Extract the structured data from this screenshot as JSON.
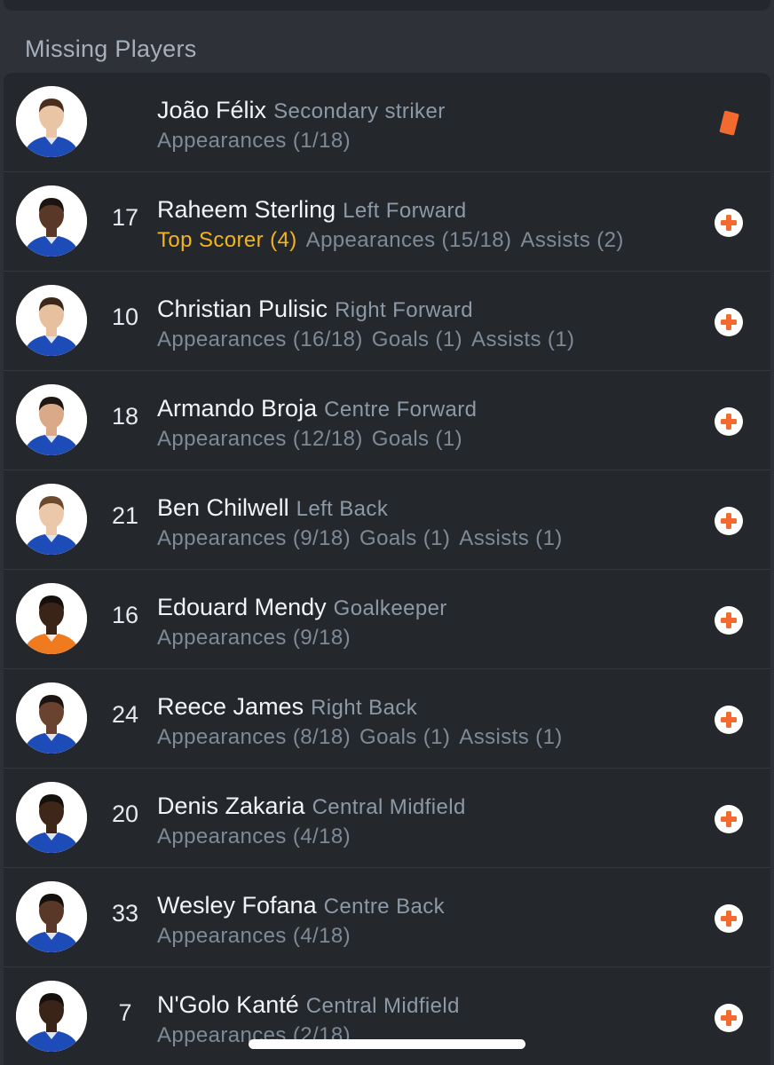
{
  "section": {
    "title": "Missing Players"
  },
  "colors": {
    "background": "#2e3238",
    "card": "#24282d",
    "accent_injury": "#f26a2e",
    "top_scorer": "#f2b51c",
    "kit_blue": "#1d4bb8"
  },
  "players": [
    {
      "number": "",
      "name": "João Félix",
      "position": "Secondary striker",
      "top_scorer": "",
      "stats": [
        "Appearances (1/18)"
      ],
      "status": "red-card-icon",
      "skin": "#e9c5a5",
      "hair": "#4a2d1c",
      "kit": "#1d4bb8"
    },
    {
      "number": "17",
      "name": "Raheem Sterling",
      "position": "Left Forward",
      "top_scorer": "Top Scorer (4)",
      "stats": [
        "Appearances (15/18)",
        "Assists (2)"
      ],
      "status": "injury-icon",
      "skin": "#5a3828",
      "hair": "#1b1410",
      "kit": "#1d4bb8"
    },
    {
      "number": "10",
      "name": "Christian Pulisic",
      "position": "Right Forward",
      "top_scorer": "",
      "stats": [
        "Appearances (16/18)",
        "Goals (1)",
        "Assists (1)"
      ],
      "status": "injury-icon",
      "skin": "#e7c0a0",
      "hair": "#3b2818",
      "kit": "#1d4bb8"
    },
    {
      "number": "18",
      "name": "Armando Broja",
      "position": "Centre Forward",
      "top_scorer": "",
      "stats": [
        "Appearances (12/18)",
        "Goals (1)"
      ],
      "status": "injury-icon",
      "skin": "#d9a988",
      "hair": "#1e1712",
      "kit": "#1d4bb8"
    },
    {
      "number": "21",
      "name": "Ben Chilwell",
      "position": "Left Back",
      "top_scorer": "",
      "stats": [
        "Appearances (9/18)",
        "Goals (1)",
        "Assists (1)"
      ],
      "status": "injury-icon",
      "skin": "#ecc8aa",
      "hair": "#6b4a2e",
      "kit": "#1d4bb8"
    },
    {
      "number": "16",
      "name": "Edouard Mendy",
      "position": "Goalkeeper",
      "top_scorer": "",
      "stats": [
        "Appearances (9/18)"
      ],
      "status": "injury-icon",
      "skin": "#3a2418",
      "hair": "#15100c",
      "kit": "#f07a1e"
    },
    {
      "number": "24",
      "name": "Reece James",
      "position": "Right Back",
      "top_scorer": "",
      "stats": [
        "Appearances (8/18)",
        "Goals (1)",
        "Assists (1)"
      ],
      "status": "injury-icon",
      "skin": "#6a4330",
      "hair": "#1b1410",
      "kit": "#1d4bb8"
    },
    {
      "number": "20",
      "name": "Denis Zakaria",
      "position": "Central Midfield",
      "top_scorer": "",
      "stats": [
        "Appearances (4/18)"
      ],
      "status": "injury-icon",
      "skin": "#3e2619",
      "hair": "#15100c",
      "kit": "#1d4bb8"
    },
    {
      "number": "33",
      "name": "Wesley Fofana",
      "position": "Centre Back",
      "top_scorer": "",
      "stats": [
        "Appearances (4/18)"
      ],
      "status": "injury-icon",
      "skin": "#5a3828",
      "hair": "#15100c",
      "kit": "#1d4bb8"
    },
    {
      "number": "7",
      "name": "N'Golo Kanté",
      "position": "Central Midfield",
      "top_scorer": "",
      "stats": [
        "Appearances (2/18)"
      ],
      "status": "injury-icon",
      "skin": "#3a2418",
      "hair": "#15100c",
      "kit": "#1d4bb8"
    }
  ]
}
